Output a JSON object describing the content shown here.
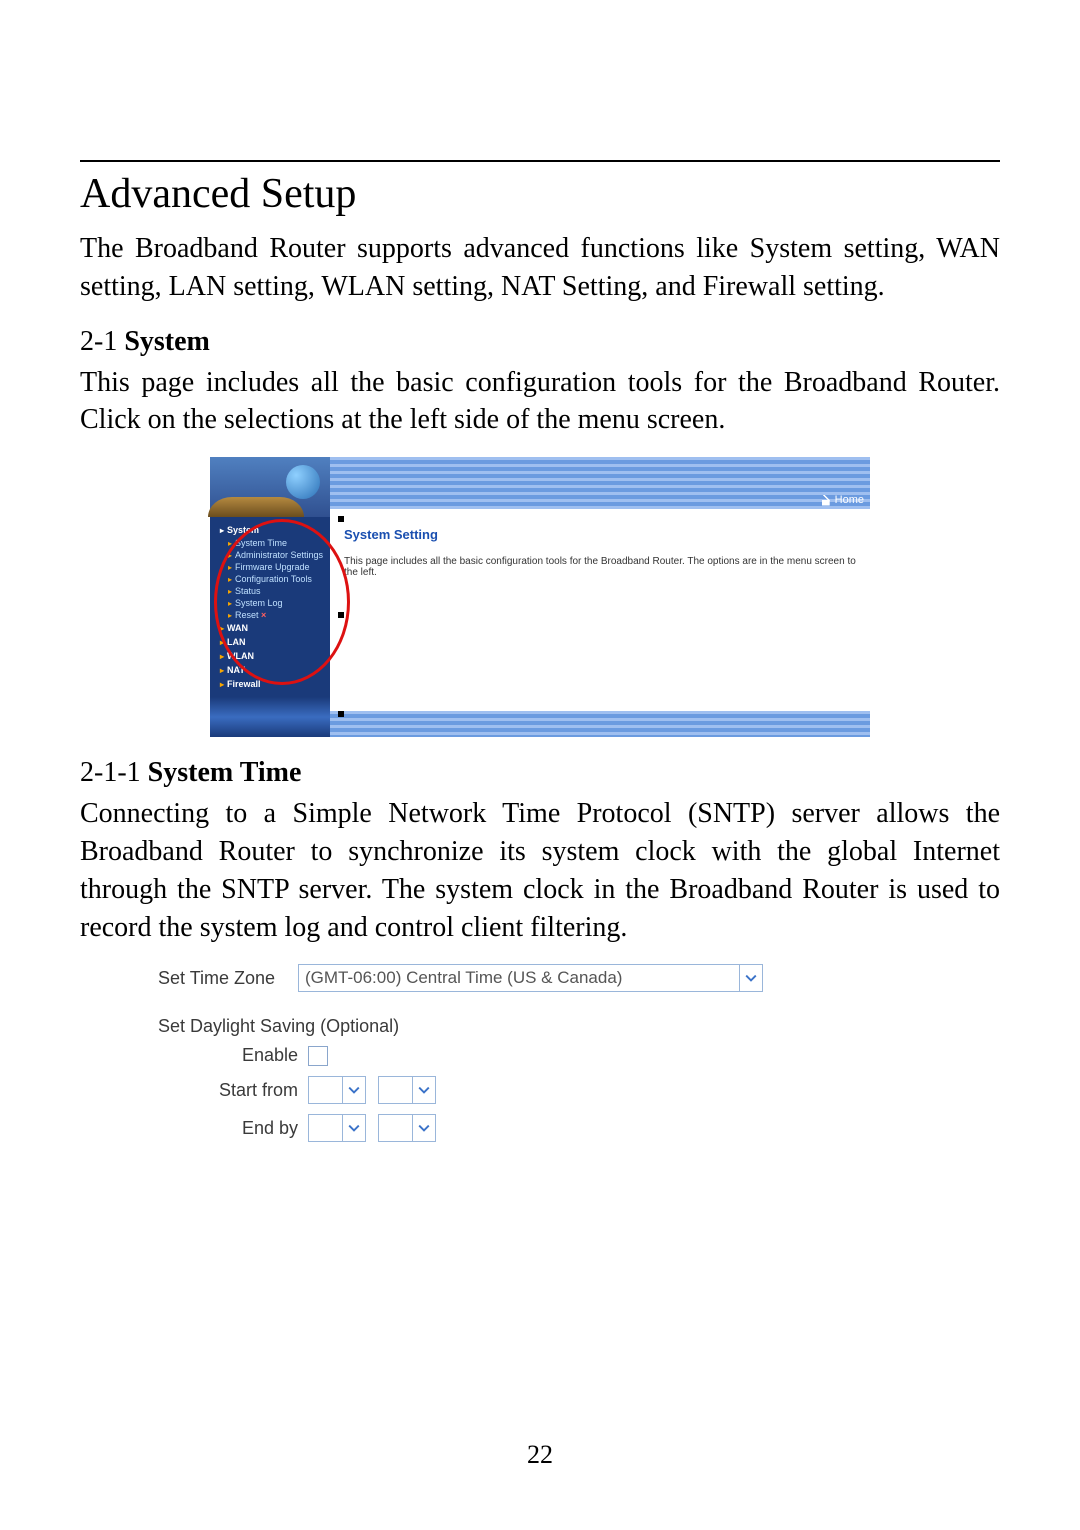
{
  "title": "Advanced Setup",
  "intro": "The Broadband Router supports advanced functions like System setting, WAN setting, LAN setting, WLAN setting, NAT Setting, and Firewall setting.",
  "sec_2_1": {
    "num": "2-1 ",
    "title": "System"
  },
  "para_2_1": "This page includes all the basic configuration tools for the Broadband Router. Click on the selections at the left side of the menu screen.",
  "router_ui": {
    "home": "Home",
    "nav_top": [
      "System",
      "WAN",
      "LAN",
      "WLAN",
      "NAT",
      "Firewall"
    ],
    "nav_sub": [
      "System Time",
      "Administrator Settings",
      "Firmware Upgrade",
      "Configuration Tools",
      "Status",
      "System Log",
      "Reset"
    ],
    "content_heading": "System Setting",
    "content_text": "This page includes all the basic configuration tools for the Broadband Router. The options are in the menu screen to the left."
  },
  "sec_2_1_1": {
    "num": "2-1-1 ",
    "title": "System Time"
  },
  "para_2_1_1": "Connecting to a Simple Network Time Protocol (SNTP) server allows the Broadband Router to synchronize its system clock with the global Internet through the SNTP server. The system clock in the Broadband Router is used to record the system log and control client filtering.",
  "time_form": {
    "set_tz_label": "Set Time Zone",
    "tz_value": "(GMT-06:00) Central Time (US & Canada)",
    "dst_heading": "Set Daylight Saving (Optional)",
    "enable_label": "Enable",
    "start_label": "Start from",
    "end_label": "End by"
  },
  "page_number": "22"
}
